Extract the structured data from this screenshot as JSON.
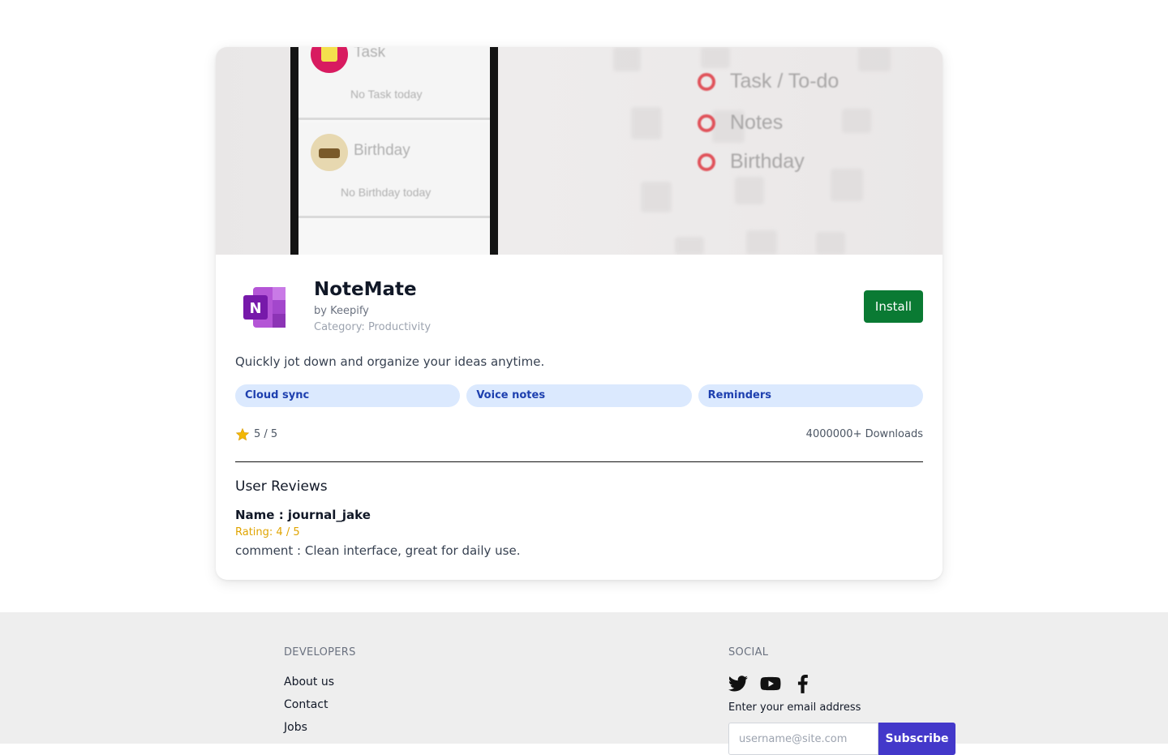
{
  "banner": {
    "phone_rows": [
      {
        "label": "Task",
        "sub": "No Task today"
      },
      {
        "label": "Birthday",
        "sub": "No Birthday today"
      }
    ],
    "legend": [
      "Task / To-do",
      "Notes",
      "Birthday"
    ]
  },
  "app": {
    "name": "NoteMate",
    "developer": "by Keepify",
    "category": "Category: Productivity",
    "install_label": "Install",
    "description": "Quickly jot down and organize your ideas anytime.",
    "tags": [
      "Cloud sync",
      "Voice notes",
      "Reminders"
    ],
    "rating": "5 / 5",
    "downloads": "4000000+ Downloads",
    "icon": "onenote-logo-icon"
  },
  "reviews": {
    "title": "User Reviews",
    "items": [
      {
        "name": "Name : journal_jake",
        "rating": "Rating: 4 / 5",
        "comment": "comment : Clean interface, great for daily use."
      }
    ]
  },
  "footer": {
    "developers_heading": "DEVELOPERS",
    "links": [
      "About us",
      "Contact",
      "Jobs"
    ],
    "social_heading": "SOCIAL",
    "social_icons": [
      "twitter-icon",
      "youtube-icon",
      "facebook-icon"
    ],
    "email_label": "Enter your email address",
    "email_placeholder": "username@site.com",
    "subscribe_label": "Subscribe"
  },
  "colors": {
    "install": "#0a7a33",
    "subscribe": "#4338ca",
    "tag_bg": "#dbe9fe",
    "tag_text": "#1e40af",
    "rating_accent": "#e0a400"
  }
}
